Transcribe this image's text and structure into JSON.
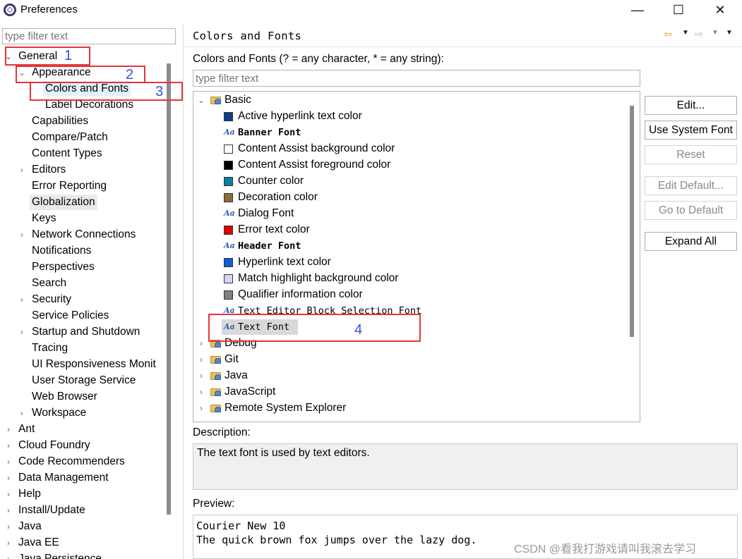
{
  "window": {
    "title": "Preferences",
    "minimize": "—",
    "maximize": "☐",
    "close": "✕"
  },
  "left": {
    "filter_placeholder": "type filter text",
    "tree": [
      {
        "label": "General",
        "indent": 0,
        "chevron": "⌄",
        "selected": ""
      },
      {
        "label": "Appearance",
        "indent": 1,
        "chevron": "⌄",
        "selected": ""
      },
      {
        "label": "Colors and Fonts",
        "indent": 2,
        "chevron": "",
        "selected": "blue"
      },
      {
        "label": "Label Decorations",
        "indent": 2,
        "chevron": "",
        "selected": ""
      },
      {
        "label": "Capabilities",
        "indent": 1,
        "chevron": "",
        "selected": ""
      },
      {
        "label": "Compare/Patch",
        "indent": 1,
        "chevron": "",
        "selected": ""
      },
      {
        "label": "Content Types",
        "indent": 1,
        "chevron": "",
        "selected": ""
      },
      {
        "label": "Editors",
        "indent": 1,
        "chevron": "›",
        "selected": ""
      },
      {
        "label": "Error Reporting",
        "indent": 1,
        "chevron": "",
        "selected": ""
      },
      {
        "label": "Globalization",
        "indent": 1,
        "chevron": "",
        "selected": "grey"
      },
      {
        "label": "Keys",
        "indent": 1,
        "chevron": "",
        "selected": ""
      },
      {
        "label": "Network Connections",
        "indent": 1,
        "chevron": "›",
        "selected": ""
      },
      {
        "label": "Notifications",
        "indent": 1,
        "chevron": "",
        "selected": ""
      },
      {
        "label": "Perspectives",
        "indent": 1,
        "chevron": "",
        "selected": ""
      },
      {
        "label": "Search",
        "indent": 1,
        "chevron": "",
        "selected": ""
      },
      {
        "label": "Security",
        "indent": 1,
        "chevron": "›",
        "selected": ""
      },
      {
        "label": "Service Policies",
        "indent": 1,
        "chevron": "",
        "selected": ""
      },
      {
        "label": "Startup and Shutdown",
        "indent": 1,
        "chevron": "›",
        "selected": ""
      },
      {
        "label": "Tracing",
        "indent": 1,
        "chevron": "",
        "selected": ""
      },
      {
        "label": "UI Responsiveness Monit",
        "indent": 1,
        "chevron": "",
        "selected": ""
      },
      {
        "label": "User Storage Service",
        "indent": 1,
        "chevron": "",
        "selected": ""
      },
      {
        "label": "Web Browser",
        "indent": 1,
        "chevron": "",
        "selected": ""
      },
      {
        "label": "Workspace",
        "indent": 1,
        "chevron": "›",
        "selected": ""
      },
      {
        "label": "Ant",
        "indent": 0,
        "chevron": "›",
        "selected": ""
      },
      {
        "label": "Cloud Foundry",
        "indent": 0,
        "chevron": "›",
        "selected": ""
      },
      {
        "label": "Code Recommenders",
        "indent": 0,
        "chevron": "›",
        "selected": ""
      },
      {
        "label": "Data Management",
        "indent": 0,
        "chevron": "›",
        "selected": ""
      },
      {
        "label": "Help",
        "indent": 0,
        "chevron": "›",
        "selected": ""
      },
      {
        "label": "Install/Update",
        "indent": 0,
        "chevron": "›",
        "selected": ""
      },
      {
        "label": "Java",
        "indent": 0,
        "chevron": "›",
        "selected": ""
      },
      {
        "label": "Java EE",
        "indent": 0,
        "chevron": "›",
        "selected": ""
      },
      {
        "label": "Java Persistence",
        "indent": 0,
        "chevron": "›",
        "selected": ""
      }
    ]
  },
  "annotations": [
    "1",
    "2",
    "3",
    "4"
  ],
  "right": {
    "title": "Colors and Fonts",
    "intro": "Colors and Fonts (? = any character, * = any string):",
    "filter_placeholder": "type filter text",
    "tree": [
      {
        "kind": "category",
        "label": "Basic",
        "expanded": true
      },
      {
        "kind": "color",
        "label": "Active hyperlink text color",
        "color": "#0b3f86"
      },
      {
        "kind": "font",
        "label": "Banner Font",
        "style": "mono-bold"
      },
      {
        "kind": "color",
        "label": "Content Assist background color",
        "color": "#ffffff"
      },
      {
        "kind": "color",
        "label": "Content Assist foreground color",
        "color": "#000000"
      },
      {
        "kind": "color",
        "label": "Counter color",
        "color": "#0a7fa3"
      },
      {
        "kind": "color",
        "label": "Decoration color",
        "color": "#8a6d3b"
      },
      {
        "kind": "font",
        "label": "Dialog Font",
        "style": "sans"
      },
      {
        "kind": "color",
        "label": "Error text color",
        "color": "#e00000"
      },
      {
        "kind": "font",
        "label": "Header Font",
        "style": "mono-bold"
      },
      {
        "kind": "color",
        "label": "Hyperlink text color",
        "color": "#0a5fd1"
      },
      {
        "kind": "color",
        "label": "Match highlight background color",
        "color": "#d7d7f5"
      },
      {
        "kind": "color",
        "label": "Qualifier information color",
        "color": "#808080"
      },
      {
        "kind": "font",
        "label": "Text Editor Block Selection Font",
        "style": "mono"
      },
      {
        "kind": "font",
        "label": "Text Font",
        "style": "mono"
      },
      {
        "kind": "category",
        "label": "Debug",
        "expanded": false
      },
      {
        "kind": "category",
        "label": "Git",
        "expanded": false
      },
      {
        "kind": "category",
        "label": "Java",
        "expanded": false
      },
      {
        "kind": "category",
        "label": "JavaScript",
        "expanded": false
      },
      {
        "kind": "category",
        "label": "Remote System Explorer",
        "expanded": false
      }
    ],
    "font_icon": "Aa",
    "buttons": {
      "edit": "Edit...",
      "use_system_font": "Use System Font",
      "reset": "Reset",
      "edit_default": "Edit Default...",
      "go_to_default": "Go to Default",
      "expand_all": "Expand All"
    },
    "description_label": "Description:",
    "description": "The text font is used by text editors.",
    "preview_label": "Preview:",
    "preview": "Courier New 10\nThe quick brown fox jumps over the lazy dog."
  },
  "watermark": "CSDN @看我打游戏请叫我滚去学习"
}
